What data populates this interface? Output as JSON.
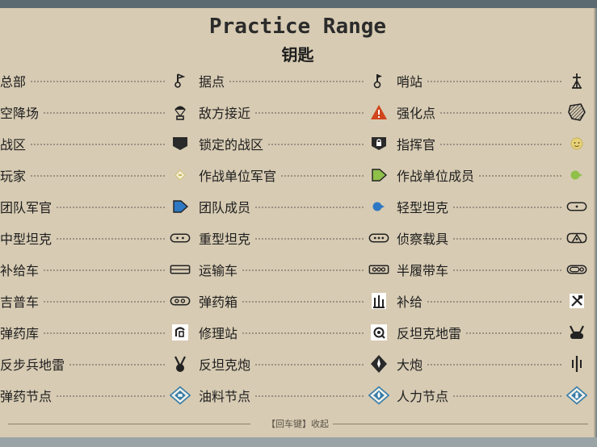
{
  "title": "Practice Range",
  "subtitle": "钥匙",
  "legend": [
    [
      {
        "label": "总部",
        "icon": "flag-icon"
      },
      {
        "label": "据点",
        "icon": "outpost-flag-icon"
      },
      {
        "label": "哨站",
        "icon": "sentry-tower-icon"
      }
    ],
    [
      {
        "label": "空降场",
        "icon": "parachute-icon"
      },
      {
        "label": "敌方接近",
        "icon": "warning-triangle-icon"
      },
      {
        "label": "强化点",
        "icon": "hatched-shield-icon"
      }
    ],
    [
      {
        "label": "战区",
        "icon": "sector-icon"
      },
      {
        "label": "锁定的战区",
        "icon": "locked-sector-icon"
      },
      {
        "label": "指挥官",
        "icon": "commander-icon"
      }
    ],
    [
      {
        "label": "玩家",
        "icon": "player-icon"
      },
      {
        "label": "作战单位军官",
        "icon": "unit-officer-icon"
      },
      {
        "label": "作战单位成员",
        "icon": "unit-member-icon"
      }
    ],
    [
      {
        "label": "团队军官",
        "icon": "team-officer-icon"
      },
      {
        "label": "团队成员",
        "icon": "team-member-icon"
      },
      {
        "label": "轻型坦克",
        "icon": "light-tank-icon"
      }
    ],
    [
      {
        "label": "中型坦克",
        "icon": "medium-tank-icon"
      },
      {
        "label": "重型坦克",
        "icon": "heavy-tank-icon"
      },
      {
        "label": "侦察载具",
        "icon": "recon-vehicle-icon"
      }
    ],
    [
      {
        "label": "补给车",
        "icon": "supply-truck-icon"
      },
      {
        "label": "运输车",
        "icon": "transport-truck-icon"
      },
      {
        "label": "半履带车",
        "icon": "halftrack-icon"
      }
    ],
    [
      {
        "label": "吉普车",
        "icon": "jeep-icon"
      },
      {
        "label": "弹药箱",
        "icon": "ammo-box-icon"
      },
      {
        "label": "补给",
        "icon": "supplies-icon"
      }
    ],
    [
      {
        "label": "弹药库",
        "icon": "ammo-depot-icon"
      },
      {
        "label": "修理站",
        "icon": "repair-station-icon"
      },
      {
        "label": "反坦克地雷",
        "icon": "at-mine-icon"
      }
    ],
    [
      {
        "label": "反步兵地雷",
        "icon": "ap-mine-icon"
      },
      {
        "label": "反坦克炮",
        "icon": "at-gun-icon"
      },
      {
        "label": "大炮",
        "icon": "artillery-icon"
      }
    ],
    [
      {
        "label": "弹药节点",
        "icon": "ammo-node-icon"
      },
      {
        "label": "油料节点",
        "icon": "fuel-node-icon"
      },
      {
        "label": "人力节点",
        "icon": "manpower-node-icon"
      }
    ]
  ],
  "footer": {
    "text": "【回车键】收起"
  },
  "colors": {
    "panel": "#d7cbb3",
    "text": "#1e1e1e",
    "dots": "#9c9182",
    "warning": "#d0451b",
    "blue": "#2e78c4",
    "green": "#8fc04a"
  }
}
